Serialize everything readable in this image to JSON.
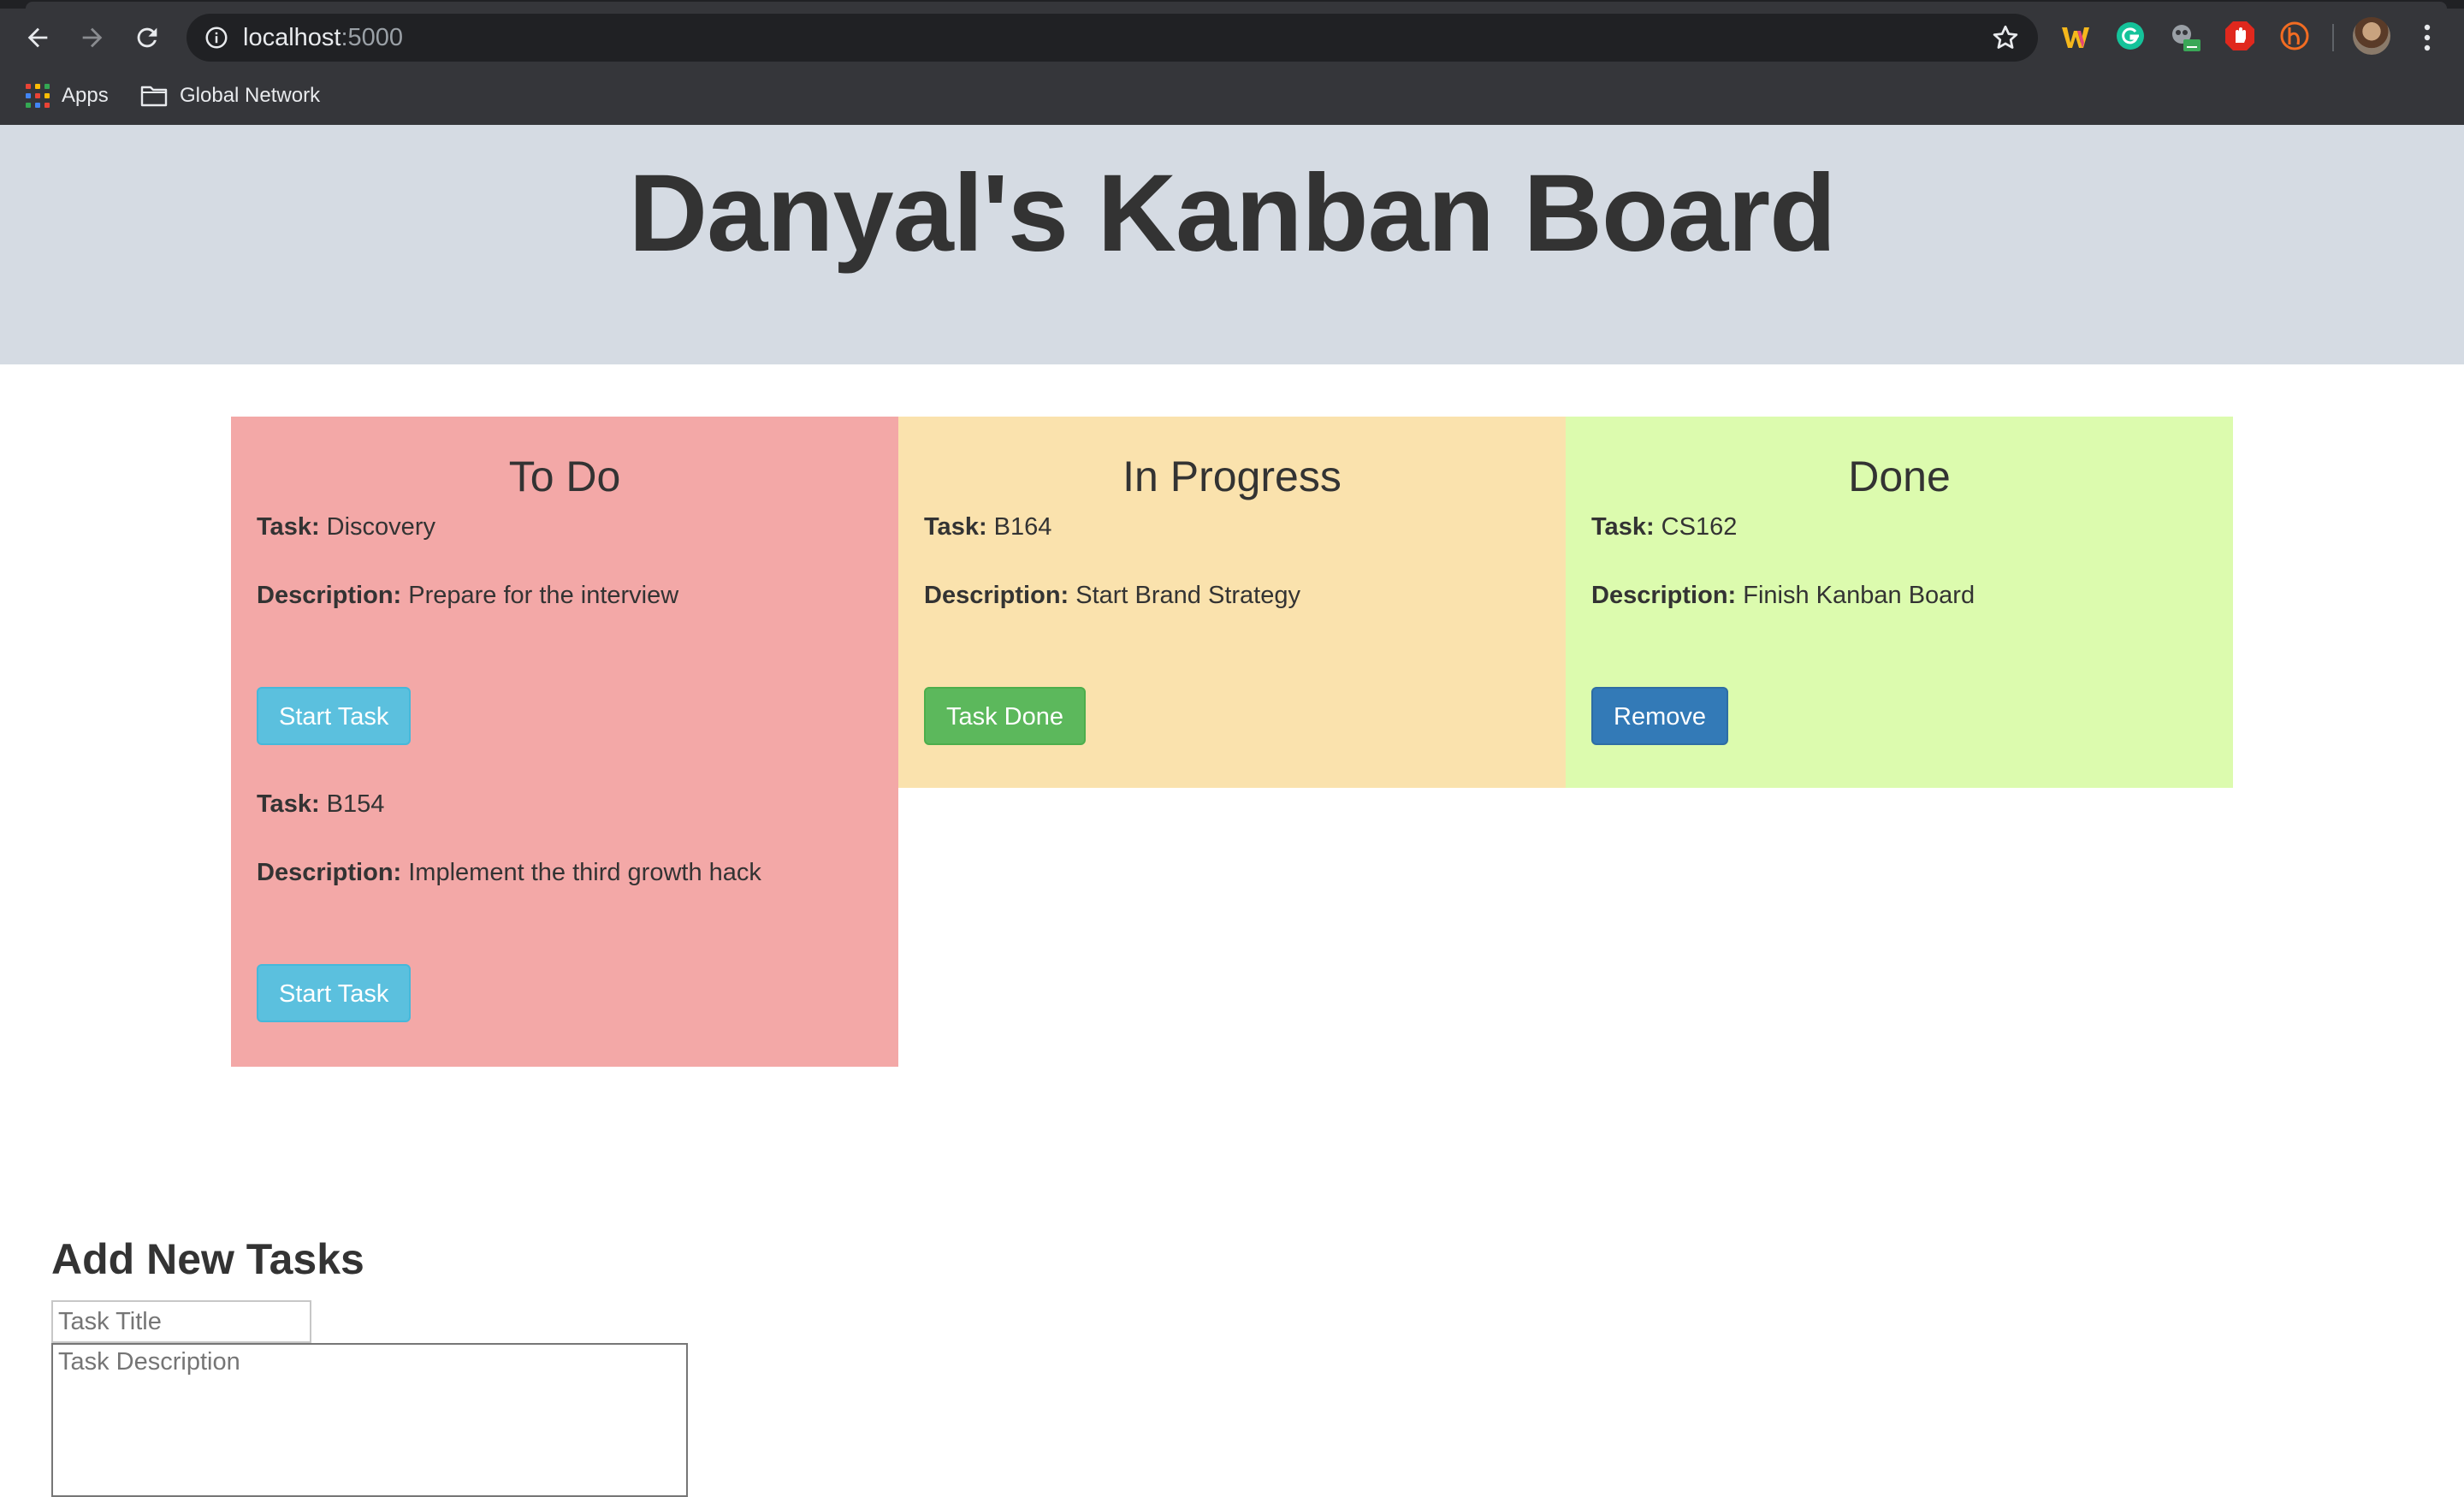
{
  "browser": {
    "url_host": "localhost",
    "url_port": ":5000",
    "bookmarks": [
      {
        "label": "Apps",
        "icon": "apps-grid-icon"
      },
      {
        "label": "Global Network",
        "icon": "folder-icon"
      }
    ],
    "extensions": [
      "w-extension-icon",
      "grammarly-icon",
      "tracker-extension-icon",
      "adblock-icon",
      "honey-icon"
    ]
  },
  "page": {
    "title": "Danyal's Kanban Board"
  },
  "columns": [
    {
      "heading": "To Do",
      "color": "#f3a8a7",
      "tasks": [
        {
          "task_label": "Task:",
          "task": "Discovery",
          "desc_label": "Description:",
          "description": "Prepare for the interview",
          "button": "Start Task"
        },
        {
          "task_label": "Task:",
          "task": "B154",
          "desc_label": "Description:",
          "description": "Implement the third growth hack",
          "button": "Start Task"
        }
      ]
    },
    {
      "heading": "In Progress",
      "color": "#fae2ad",
      "tasks": [
        {
          "task_label": "Task:",
          "task": "B164",
          "desc_label": "Description:",
          "description": "Start Brand Strategy",
          "button": "Task Done"
        }
      ]
    },
    {
      "heading": "Done",
      "color": "#dcfbae",
      "tasks": [
        {
          "task_label": "Task:",
          "task": "CS162",
          "desc_label": "Description:",
          "description": "Finish Kanban Board",
          "button": "Remove"
        }
      ]
    }
  ],
  "add_form": {
    "heading": "Add New Tasks",
    "title_placeholder": "Task Title",
    "description_placeholder": "Task Description"
  }
}
